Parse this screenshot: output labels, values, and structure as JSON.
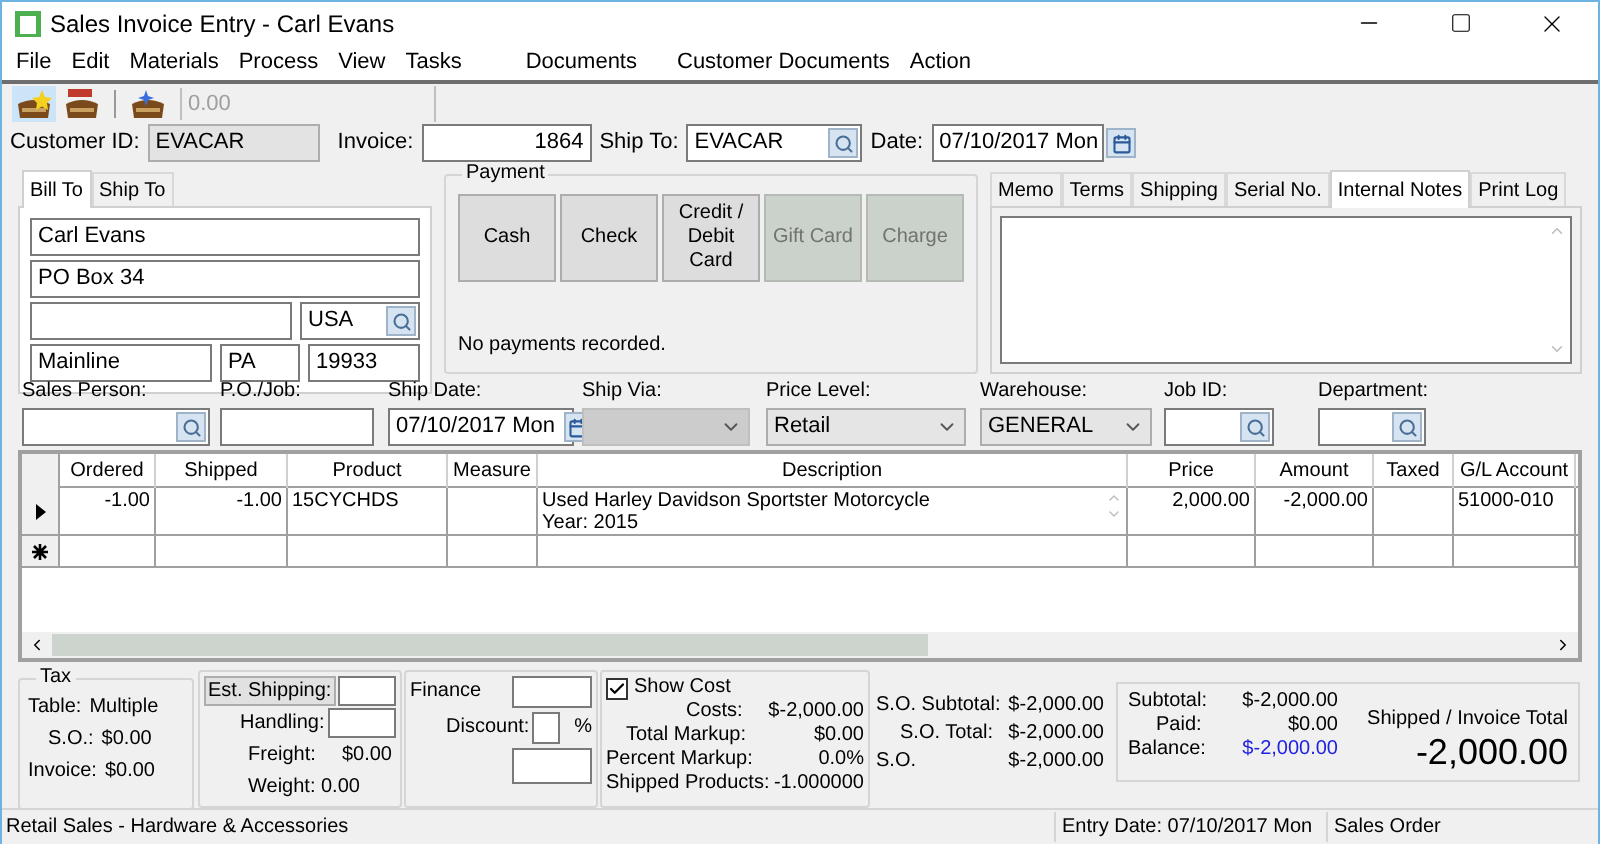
{
  "window": {
    "title": "Sales Invoice Entry - Carl Evans"
  },
  "menu": [
    "File",
    "Edit",
    "Materials",
    "Process",
    "View",
    "Tasks",
    "Documents",
    "Customer Documents",
    "Action"
  ],
  "toolbar": {
    "buttons": [
      {
        "kind": "star",
        "selected": true
      },
      {
        "kind": "label",
        "selected": false
      },
      {
        "kind": "sparkle",
        "selected": false
      }
    ],
    "amount": "0.00"
  },
  "header_fields": [
    {
      "label": "Customer ID:",
      "value": "EVACAR",
      "kind": "readonly"
    },
    {
      "label": "Invoice:",
      "value": "1864",
      "kind": "number"
    },
    {
      "label": "Ship To:",
      "value": "EVACAR",
      "kind": "lookup"
    },
    {
      "label": "Date:",
      "value": "07/10/2017 Mon",
      "kind": "date"
    }
  ],
  "address": {
    "tabs": [
      {
        "label": "Bill To",
        "selected": true
      },
      {
        "label": "Ship To",
        "selected": false
      }
    ],
    "fields": [
      {
        "kind": "full",
        "value": "Carl Evans"
      },
      {
        "kind": "full",
        "value": "PO Box 34"
      },
      {
        "kind": "line"
      },
      {
        "kind": "country",
        "value": "USA"
      },
      {
        "kind": "city",
        "value": "Mainline"
      },
      {
        "kind": "state",
        "value": "PA"
      },
      {
        "kind": "zip",
        "value": "19933"
      }
    ]
  },
  "payment": {
    "title": "Payment",
    "buttons": [
      {
        "label": "Cash",
        "disabled": false
      },
      {
        "label": "Check",
        "disabled": false
      },
      {
        "label": "Credit / Debit Card",
        "disabled": false
      },
      {
        "label": "Gift Card",
        "disabled": true
      },
      {
        "label": "Charge",
        "disabled": true
      }
    ],
    "status": "No payments recorded."
  },
  "notes": {
    "tabs": [
      {
        "label": "Memo",
        "selected": false
      },
      {
        "label": "Terms",
        "selected": false
      },
      {
        "label": "Shipping",
        "selected": false
      },
      {
        "label": "Serial No.",
        "selected": false
      },
      {
        "label": "Internal Notes",
        "selected": true
      },
      {
        "label": "Print Log",
        "selected": false
      }
    ]
  },
  "order_fields": [
    {
      "label": "Sales Person:",
      "kind": "lookup",
      "disabled": false
    },
    {
      "label": "P.O./Job:",
      "kind": "text",
      "disabled": false
    },
    {
      "label": "Ship Date:",
      "value": "07/10/2017 Mon",
      "kind": "date",
      "disabled": false
    },
    {
      "label": "Ship Via:",
      "kind": "select",
      "disabled": true
    },
    {
      "label": "Price Level:",
      "value": "Retail",
      "kind": "select",
      "disabled": false
    },
    {
      "label": "Warehouse:",
      "value": "GENERAL",
      "kind": "select",
      "disabled": false
    },
    {
      "label": "Job ID:",
      "kind": "lookup",
      "disabled": false
    },
    {
      "label": "Department:",
      "kind": "lookup",
      "disabled": false
    }
  ],
  "lines": {
    "columns": [
      "Ordered",
      "Shipped",
      "Product",
      "Measure",
      "Description",
      "Price",
      "Amount",
      "Taxed",
      "G/L Account"
    ],
    "rows": [
      {
        "kind": "current",
        "cells": [
          "-1.00",
          "-1.00",
          "15CYCHDS",
          null,
          "Used Harley Davidson Sportster Motorcycle\nYear: 2015",
          "2,000.00",
          "-2,000.00",
          null,
          "51000-010"
        ]
      },
      {
        "kind": "new"
      }
    ]
  },
  "tax": {
    "title": "Tax",
    "rows": [
      {
        "label": "Table:",
        "value": "Multiple"
      },
      {
        "label": "S.O.:",
        "value": "$0.00"
      },
      {
        "label": "Invoice:",
        "value": "$0.00"
      }
    ]
  },
  "shipping": {
    "button": "Est. Shipping:",
    "handling": "Handling:",
    "freight": {
      "label": "Freight:",
      "value": "$0.00"
    },
    "weight": "Weight: 0.00"
  },
  "finance": {
    "label": "Finance",
    "discount": "Discount:",
    "percent": "%"
  },
  "cost": {
    "show_cost": {
      "label": "Show Cost",
      "checked": true
    },
    "rows": [
      {
        "label": "Costs:",
        "value": "$-2,000.00"
      },
      {
        "label": "Total Markup:",
        "value": "$0.00"
      },
      {
        "label": "Percent Markup:",
        "value": "0.0%"
      },
      {
        "label": "Shipped Products:",
        "value": "-1.000000"
      }
    ]
  },
  "so": {
    "rows": [
      {
        "label": "S.O. Subtotal:",
        "value": "$-2,000.00"
      },
      {
        "label": "S.O. Total:",
        "value": "$-2,000.00"
      },
      {
        "label": "S.O.",
        "value": "$-2,000.00"
      }
    ]
  },
  "totals": {
    "rows": [
      {
        "label": "Subtotal:",
        "value": "$-2,000.00",
        "highlight": false
      },
      {
        "label": "Paid:",
        "value": "$0.00",
        "highlight": false
      },
      {
        "label": "Balance:",
        "value": "$-2,000.00",
        "highlight": true
      }
    ],
    "caption": "Shipped / Invoice Total",
    "total": "-2,000.00"
  },
  "status_bar": [
    "Retail Sales - Hardware & Accessories",
    "Entry Date: 07/10/2017 Mon",
    "Sales Order"
  ]
}
